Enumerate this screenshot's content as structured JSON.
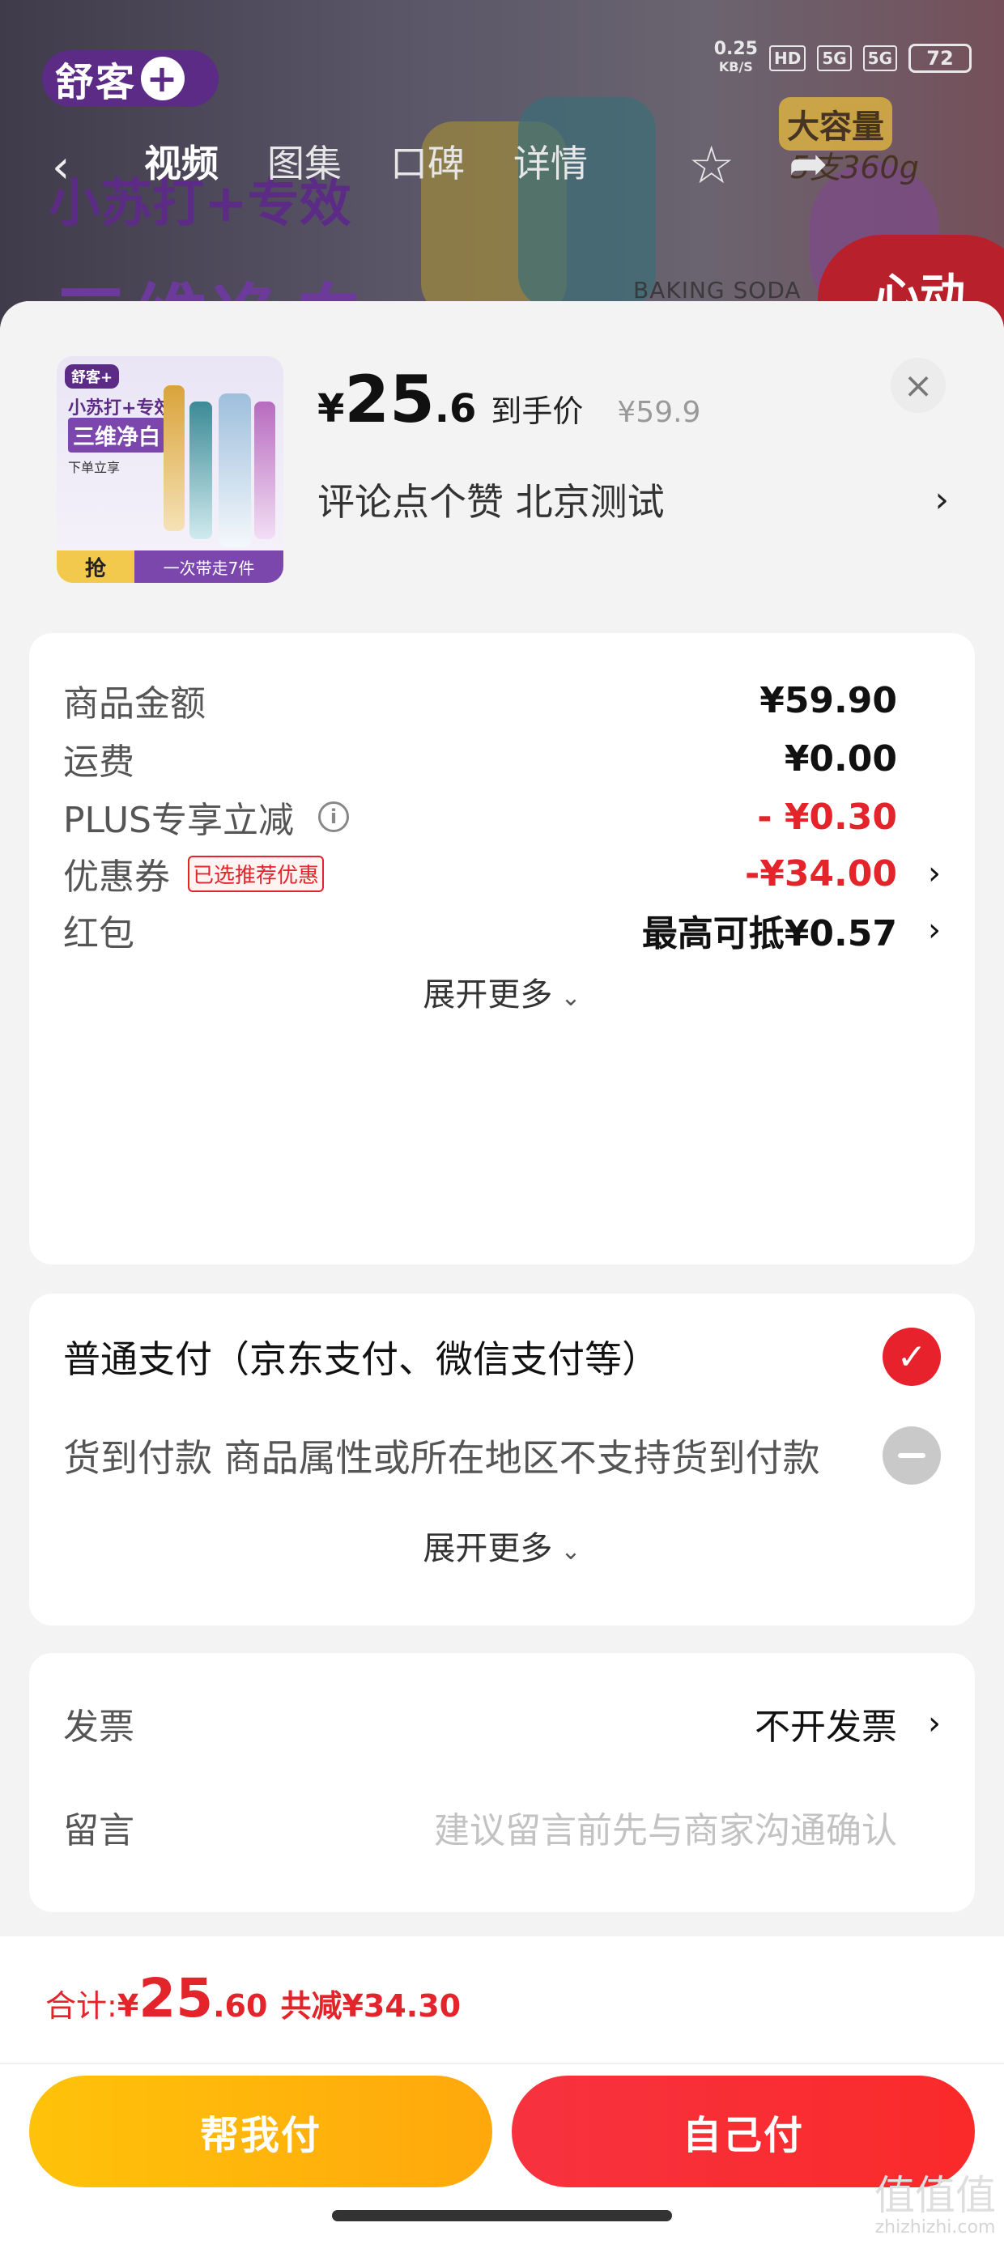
{
  "background": {
    "brand": "舒客",
    "promo_line1": "小苏打+专效",
    "promo_line2": "三维净白",
    "promo_badge": "心动",
    "capacity_badge": "大容量",
    "capacity_size": "5支360g",
    "baking_text": "BAKING SODA",
    "status_bar": {
      "speed": "0.25",
      "speed_unit": "KB/S",
      "hd": "HD",
      "net1": "5G",
      "net2": "5G",
      "battery": "72"
    },
    "nav": {
      "back_icon": "chevron-left-icon",
      "tabs": [
        "视频",
        "图集",
        "口碑",
        "详情"
      ],
      "favorite_icon": "star-icon",
      "share_icon": "share-icon"
    }
  },
  "product": {
    "thumb": {
      "brand": "舒客+",
      "line1": "小苏打+专效",
      "line2": "三维净白",
      "line3": "下单立享",
      "grab": "抢",
      "deal": "一次带走7件"
    },
    "price_symbol": "¥",
    "price_int": "25",
    "price_dec": ".6",
    "price_label": "到手价",
    "original_price": "¥59.9",
    "spec": "评论点个赞  北京测试"
  },
  "summary": {
    "rows": [
      {
        "label": "商品金额",
        "value": "¥59.90"
      },
      {
        "label": "运费",
        "value": "¥0.00"
      },
      {
        "label": "PLUS专享立减",
        "value": "- ¥0.30"
      },
      {
        "label": "优惠券",
        "tag": "已选推荐优惠",
        "value": "-¥34.00"
      },
      {
        "label": "红包",
        "value": "最高可抵¥0.57"
      }
    ],
    "expand": "展开更多"
  },
  "payment": {
    "options": [
      {
        "label": "普通支付（京东支付、微信支付等）",
        "selected": true
      },
      {
        "label": "货到付款 商品属性或所在地区不支持货到付款",
        "selected": false
      }
    ],
    "expand": "展开更多"
  },
  "extras": {
    "invoice_label": "发票",
    "invoice_value": "不开发票",
    "message_label": "留言",
    "message_placeholder": "建议留言前先与商家沟通确认"
  },
  "footer": {
    "total_label": "合计:",
    "total_symbol": "¥",
    "total_int": "25",
    "total_dec": ".60",
    "total_saved": "共减¥34.30",
    "help_pay": "帮我付",
    "self_pay": "自己付"
  },
  "watermark": {
    "logo": "值值值",
    "site": "zhizhizhi.com"
  },
  "colors": {
    "accent_red": "#e3242b",
    "help_btn": "#ffb20b",
    "self_btn": "#f7323f"
  }
}
